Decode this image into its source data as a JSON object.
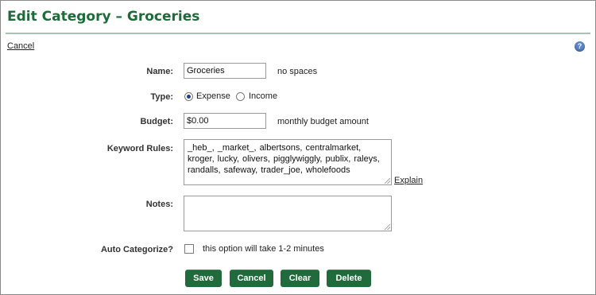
{
  "header": {
    "title": "Edit Category – Groceries",
    "cancel_link": "Cancel",
    "help_icon": "?"
  },
  "form": {
    "name": {
      "label": "Name:",
      "value": "Groceries",
      "hint": "no spaces"
    },
    "type": {
      "label": "Type:",
      "options": [
        {
          "label": "Expense",
          "selected": true
        },
        {
          "label": "Income",
          "selected": false
        }
      ]
    },
    "budget": {
      "label": "Budget:",
      "value": "$0.00",
      "hint": "monthly budget amount"
    },
    "keyword_rules": {
      "label": "Keyword Rules:",
      "value": "_heb_, _market_, albertsons, centralmarket, kroger, lucky, olivers, pigglywiggly, publix, raleys, randalls, safeway, trader_joe, wholefoods",
      "explain_link": "Explain"
    },
    "notes": {
      "label": "Notes:",
      "value": ""
    },
    "auto_categorize": {
      "label": "Auto Categorize?",
      "checked": false,
      "hint": "this option will take 1-2 minutes"
    }
  },
  "buttons": {
    "save": "Save",
    "cancel": "Cancel",
    "clear": "Clear",
    "delete": "Delete"
  },
  "colors": {
    "brand_green": "#1f6b3b",
    "title_green": "#1e6b3a",
    "rule": "#a7c4b0"
  }
}
